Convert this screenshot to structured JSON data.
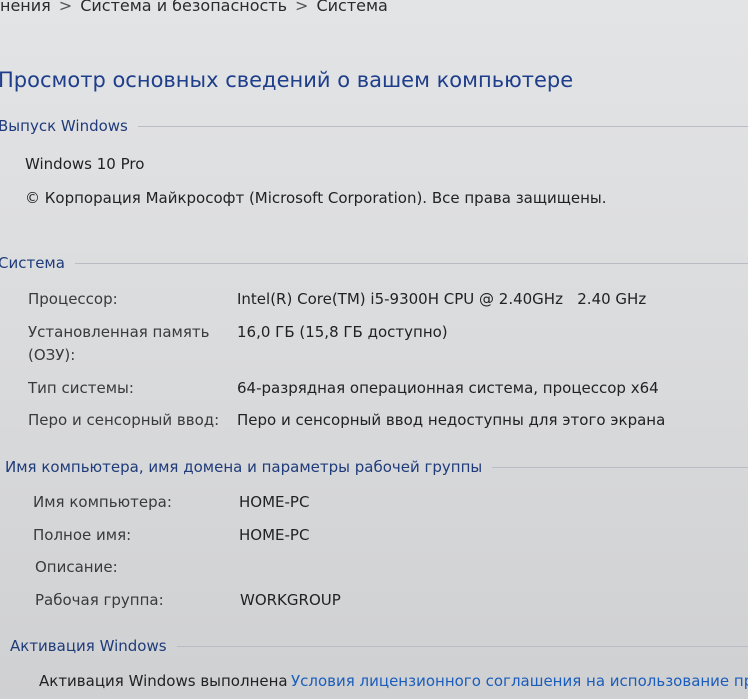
{
  "breadcrumb": {
    "item1": "нения",
    "sep": ">",
    "item2": "Система и безопасность",
    "item3": "Система"
  },
  "page_title": "Просмотр основных сведений о вашем компьютере",
  "windows_edition": {
    "header": "Выпуск Windows",
    "edition": "Windows 10 Pro",
    "copyright": "© Корпорация Майкрософт (Microsoft Corporation). Все права защищены."
  },
  "system": {
    "header": "Система",
    "processor_label": "Процессор:",
    "processor_value": "Intel(R) Core(TM) i5-9300H CPU @ 2.40GHz   2.40 GHz",
    "memory_label_line1": "Установленная память",
    "memory_label_line2": "(ОЗУ):",
    "memory_value": "16,0 ГБ (15,8 ГБ доступно)",
    "type_label": "Тип системы:",
    "type_value": "64-разрядная операционная система, процессор x64",
    "pen_label": "Перо и сенсорный ввод:",
    "pen_value": "Перо и сенсорный ввод недоступны для этого экрана"
  },
  "computer_name": {
    "header": "Имя компьютера, имя домена и параметры рабочей группы",
    "name_label": "Имя компьютера:",
    "name_value": "HOME-PC",
    "full_name_label": "Полное имя:",
    "full_name_value": "HOME-PC",
    "description_label": "Описание:",
    "workgroup_label": "Рабочая группа:",
    "workgroup_value": "WORKGROUP"
  },
  "activation": {
    "header": "Активация Windows",
    "status": "Активация Windows выполнена",
    "license_link": "Условия лицензионного соглашения на использование про"
  }
}
